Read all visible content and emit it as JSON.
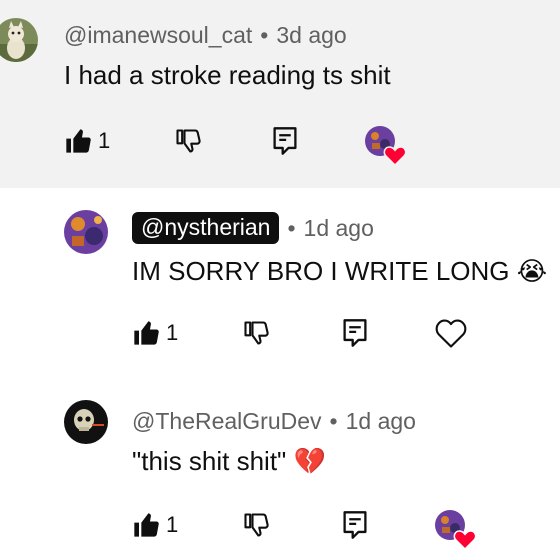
{
  "comments": [
    {
      "handle": "@imanewsoul_cat",
      "separator": "•",
      "time": "3d ago",
      "text": "I had a stroke reading ts shit",
      "likes": "1",
      "creator_hearted": true,
      "avatar_icon": "cat-avatar",
      "highlighted": true
    },
    {
      "handle": "@nystherian",
      "separator": "•",
      "time": "1d ago",
      "text": "IM SORRY BRO I WRITE LONG",
      "emoji": "😭",
      "likes": "1",
      "creator_hearted": false,
      "avatar_icon": "purple-art-avatar",
      "is_creator": true
    },
    {
      "handle": "@TheRealGruDev",
      "separator": "•",
      "time": "1d ago",
      "text": "\"this shit shit\"",
      "emoji": "💔",
      "likes": "1",
      "creator_hearted": true,
      "avatar_icon": "skeleton-avatar"
    }
  ],
  "colors": {
    "highlight_bg": "#f2f2f2",
    "heart_red": "#ff0033",
    "muted_text": "#606060",
    "creator_chip": "#0f0f0f"
  }
}
